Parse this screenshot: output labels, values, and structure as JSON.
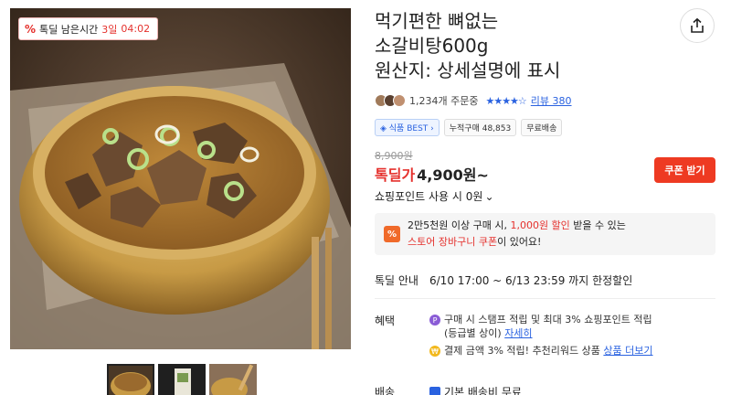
{
  "deal_badge": {
    "pct_icon": "%",
    "label": "톡딜 남은시간",
    "days": "3일",
    "time": "04:02"
  },
  "title_lines": [
    "먹기편한 뼈없는",
    "소갈비탕600g",
    "원산지: 상세설명에 표시"
  ],
  "share_icon": "share-icon",
  "meta": {
    "orders": "1,234개 주문중",
    "stars": "★★★★☆",
    "review": "리뷰 380"
  },
  "tags": {
    "best": "◈ 식품 BEST ›",
    "cumulative": "누적구매 48,853",
    "shipping": "무료배송"
  },
  "price": {
    "original": "8,900원",
    "label": "톡딜가",
    "value": "4,900원~",
    "coupon_button": "쿠폰 받기",
    "points": "쇼핑포인트 사용 시 0원",
    "points_chevron": "⌄"
  },
  "promo": {
    "icon": "%",
    "line1_a": "2만5천원 이상 구매 시, ",
    "line1_b": "1,000원 할인",
    "line1_c": " 받을 수 있는",
    "line2_a": "스토어 장바구니 쿠폰",
    "line2_b": "이 있어요!"
  },
  "deal_info": {
    "label": "톡딜 안내",
    "text": "6/10 17:00 ~ 6/13 23:59 까지 한정할인"
  },
  "benefit": {
    "label": "혜택",
    "item1_icon": "P",
    "item1_a": "구매 시 스탬프 적립 및 최대 3% 쇼핑포인트 적립",
    "item1_b": "(등급별 상이) ",
    "item1_link": "자세히",
    "item2_icon": "₩",
    "item2_a": "결제 금액 3% 적립! 추천리워드 상품 ",
    "item2_link": "상품 더보기"
  },
  "shipping": {
    "label": "배송",
    "text": "기본 배송비 무료"
  }
}
